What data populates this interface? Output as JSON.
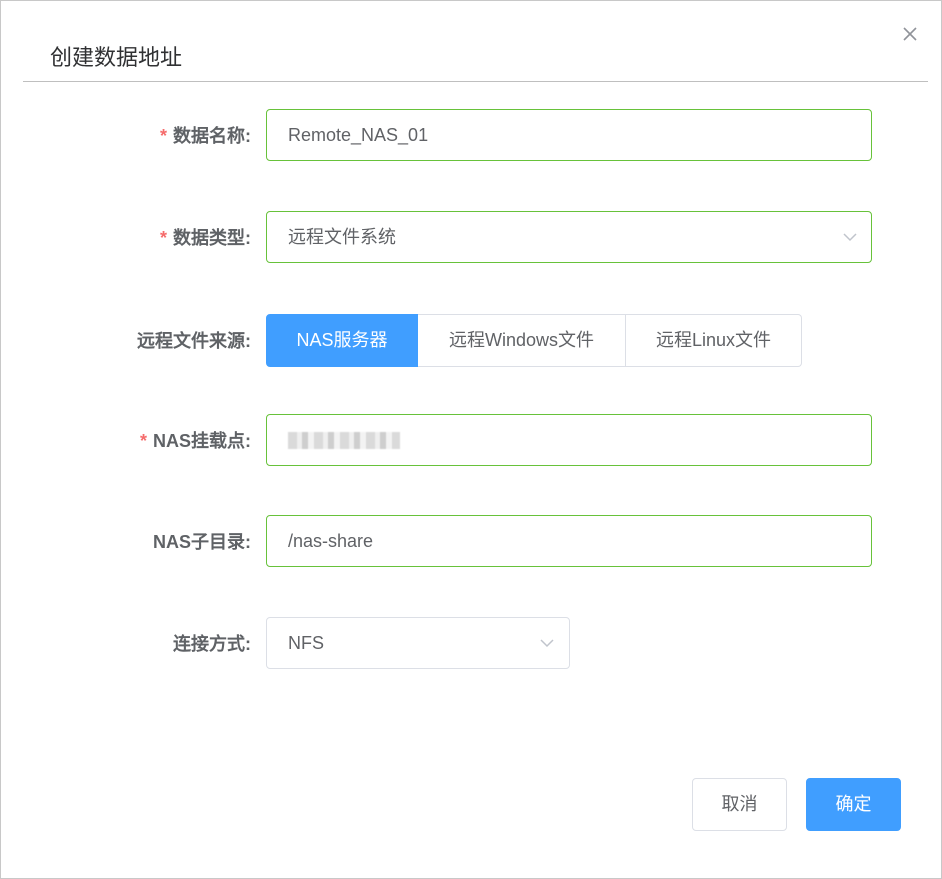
{
  "dialog": {
    "title": "创建数据地址",
    "close_icon": "close-icon"
  },
  "form": {
    "data_name": {
      "required": "*",
      "label": "数据名称:",
      "value": "Remote_NAS_01"
    },
    "data_type": {
      "required": "*",
      "label": "数据类型:",
      "value": "远程文件系统",
      "icon": "chevron-down-icon"
    },
    "remote_source": {
      "label": "远程文件来源:",
      "options": [
        "NAS服务器",
        "远程Windows文件",
        "远程Linux文件"
      ],
      "selected": "NAS服务器"
    },
    "nas_mount_point": {
      "required": "*",
      "label": "NAS挂载点:",
      "value_masked": true
    },
    "nas_subdir": {
      "label": "NAS子目录:",
      "value": "/nas-share"
    },
    "connection_method": {
      "label": "连接方式:",
      "value": "NFS",
      "icon": "chevron-down-icon"
    }
  },
  "footer": {
    "cancel_label": "取消",
    "confirm_label": "确定"
  },
  "colors": {
    "primary": "#409eff",
    "valid_border": "#67c23a",
    "required": "#f56c6c"
  }
}
